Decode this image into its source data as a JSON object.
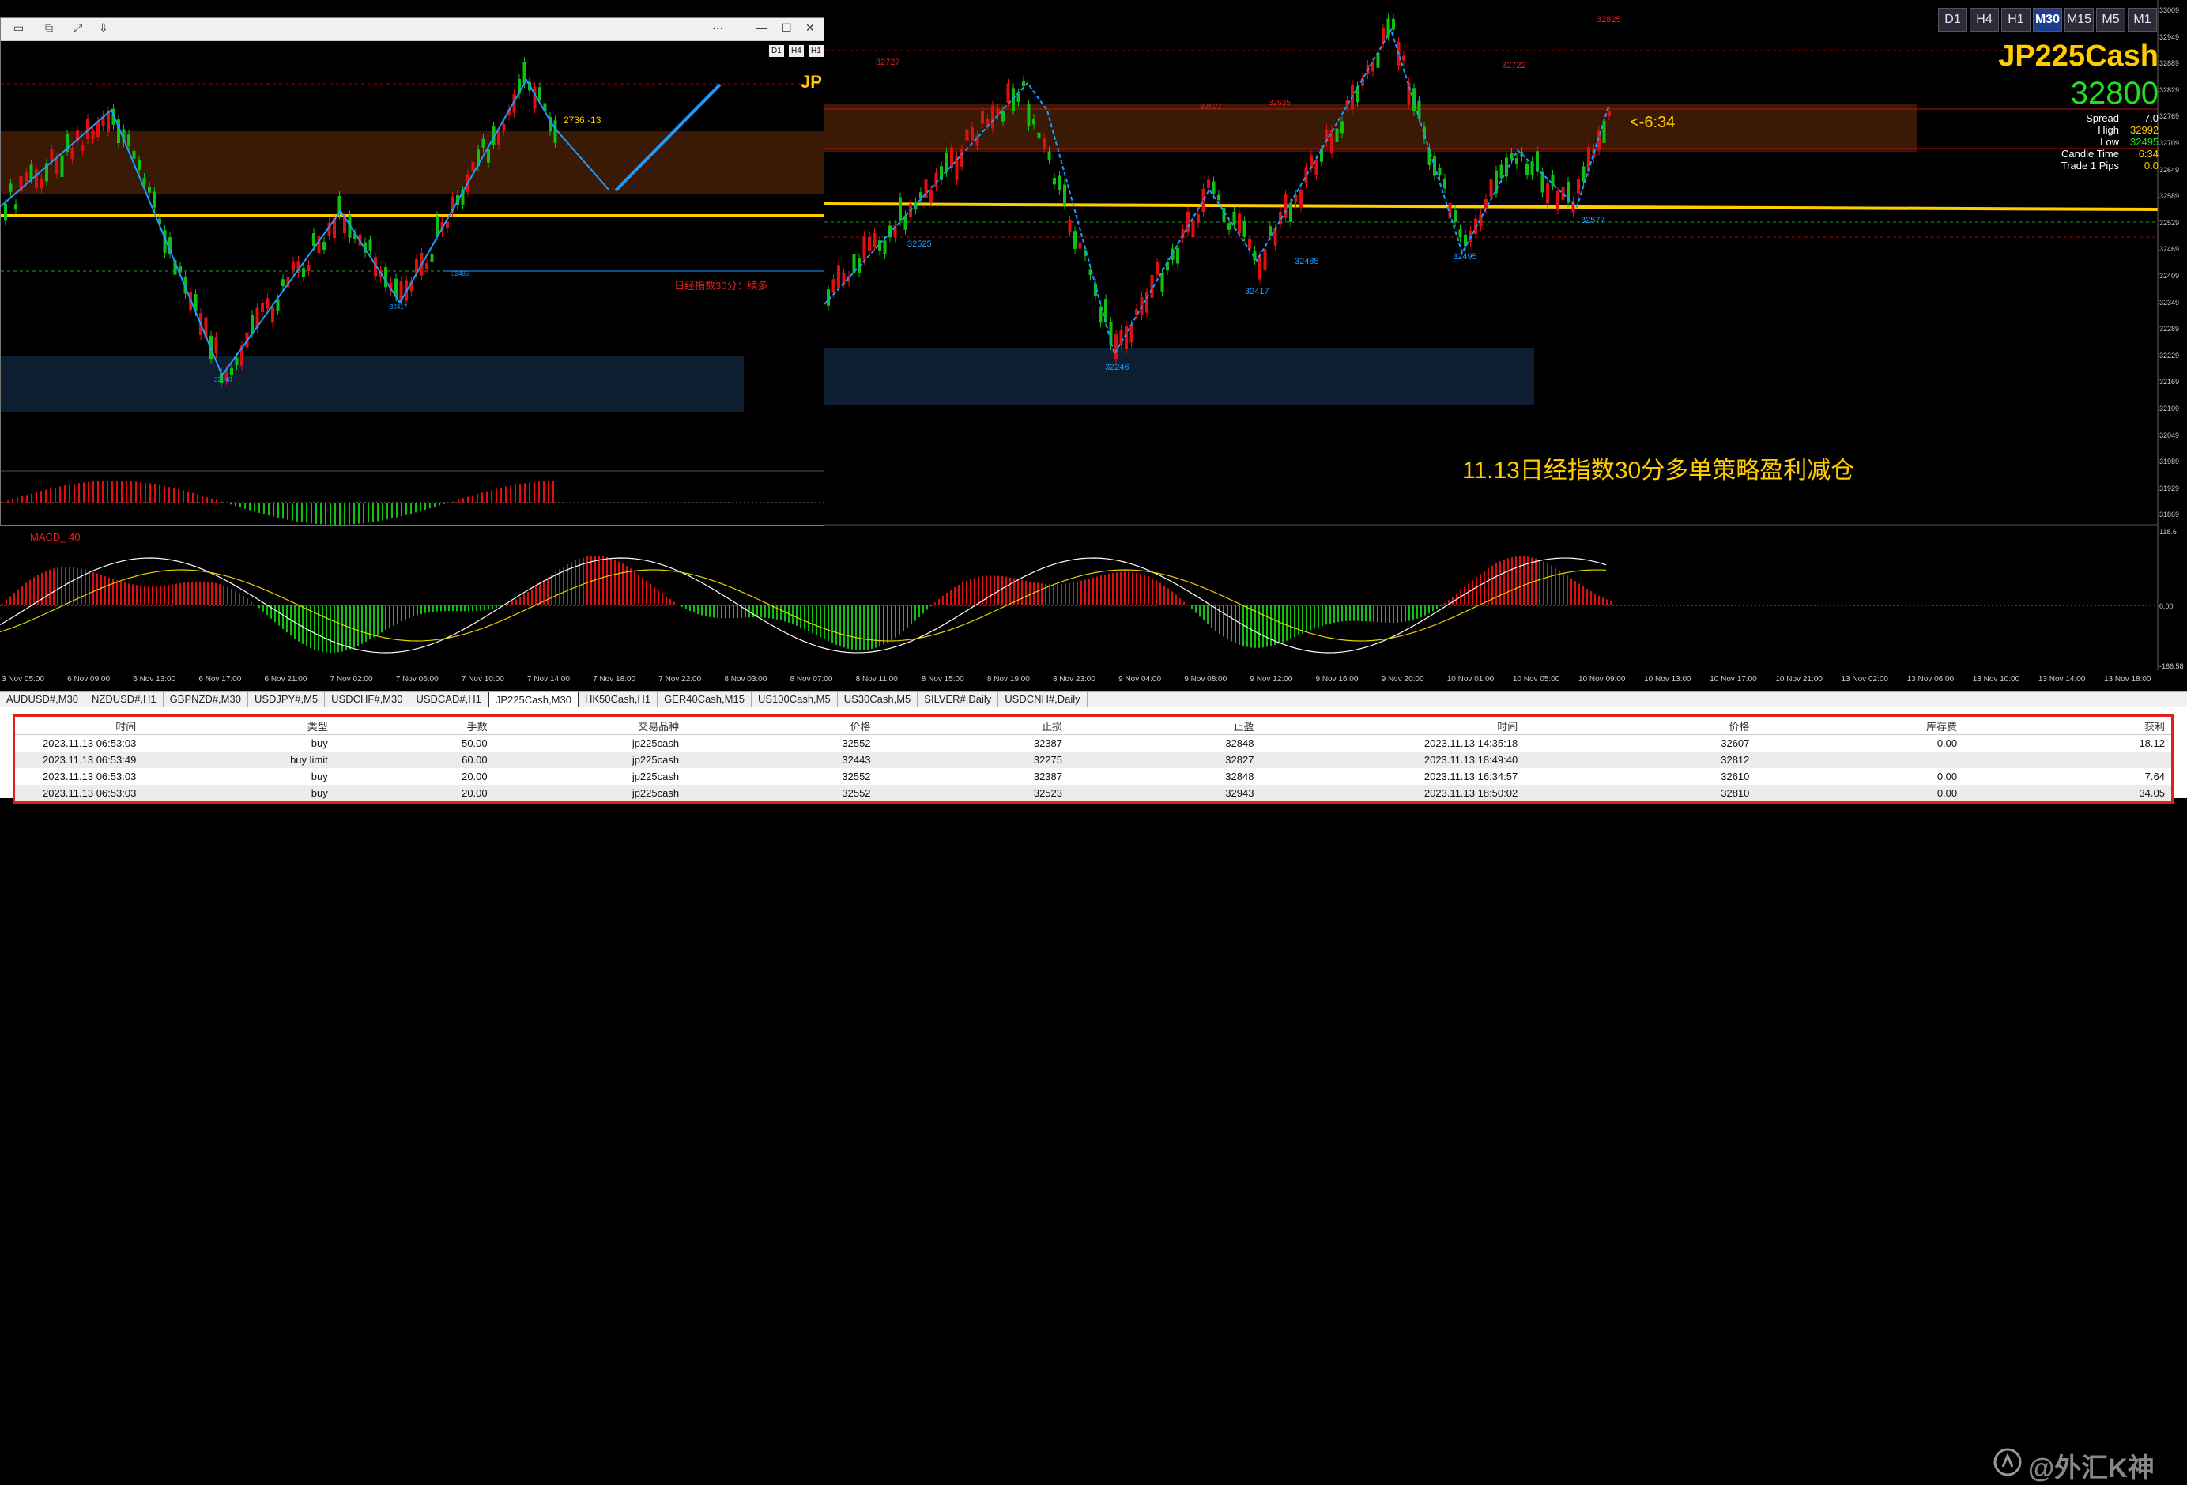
{
  "symbol": {
    "name": "JP225Cash",
    "price": "32800",
    "spread_label": "Spread",
    "spread": "7.0",
    "high_label": "High",
    "high": "32992",
    "low_label": "Low",
    "low": "32495",
    "candle_label": "Candle Time",
    "candle_time": "6:34",
    "trade_label": "Trade 1 Pips",
    "trade_pips": "0.0"
  },
  "timeframes": [
    {
      "label": "D1",
      "active": false
    },
    {
      "label": "H4",
      "active": false
    },
    {
      "label": "H1",
      "active": false
    },
    {
      "label": "M30",
      "active": true
    },
    {
      "label": "M15",
      "active": false
    },
    {
      "label": "M5",
      "active": false
    },
    {
      "label": "M1",
      "active": false
    }
  ],
  "chart": {
    "countdown": "<-6:34",
    "caption": "11.13日经指数30分多单策略盈利减仓",
    "macd_label": "MACD_ 40",
    "labels": {
      "high_32825": "32825",
      "l_32727": "32727",
      "l_32722": "32722",
      "l_32627": "32627",
      "l_32635": "32635",
      "l_32525": "32525",
      "l_32246": "32246",
      "l_32417": "32417",
      "l_32485": "32485",
      "l_32495": "32495",
      "l_32577": "32577"
    },
    "price_axis": [
      "33009",
      "32949",
      "32889",
      "32829",
      "32769",
      "32709",
      "32649",
      "32589",
      "32529",
      "32469",
      "32409",
      "32349",
      "32289",
      "32229",
      "32169",
      "32109",
      "32049",
      "31989",
      "31929",
      "31869"
    ],
    "macd_axis": [
      "118.6",
      "0.00",
      "-166.58"
    ],
    "date_axis": [
      "3 Nov 05:00",
      "6 Nov 09:00",
      "6 Nov 13:00",
      "6 Nov 17:00",
      "6 Nov 21:00",
      "7 Nov 02:00",
      "7 Nov 06:00",
      "7 Nov 10:00",
      "7 Nov 14:00",
      "7 Nov 18:00",
      "7 Nov 22:00",
      "8 Nov 03:00",
      "8 Nov 07:00",
      "8 Nov 11:00",
      "8 Nov 15:00",
      "8 Nov 19:00",
      "8 Nov 23:00",
      "9 Nov 04:00",
      "9 Nov 08:00",
      "9 Nov 12:00",
      "9 Nov 16:00",
      "9 Nov 20:00",
      "10 Nov 01:00",
      "10 Nov 05:00",
      "10 Nov 09:00",
      "10 Nov 13:00",
      "10 Nov 17:00",
      "10 Nov 21:00",
      "13 Nov 02:00",
      "13 Nov 06:00",
      "13 Nov 10:00",
      "13 Nov 14:00",
      "13 Nov 18:00"
    ]
  },
  "float_window": {
    "ticker_partial": "JP",
    "annotation": "2736:-13",
    "note": "日经指数30分：续多",
    "mini_tf": [
      "D1",
      "H4",
      "H1"
    ],
    "labels": {
      "a": "32246",
      "b": "32417",
      "c": "32485"
    }
  },
  "tabs": [
    {
      "label": "AUDUSD#,M30",
      "active": false
    },
    {
      "label": "NZDUSD#,H1",
      "active": false
    },
    {
      "label": "GBPNZD#,M30",
      "active": false
    },
    {
      "label": "USDJPY#,M5",
      "active": false
    },
    {
      "label": "USDCHF#,M30",
      "active": false
    },
    {
      "label": "USDCAD#,H1",
      "active": false
    },
    {
      "label": "JP225Cash,M30",
      "active": true
    },
    {
      "label": "HK50Cash,H1",
      "active": false
    },
    {
      "label": "GER40Cash,M15",
      "active": false
    },
    {
      "label": "US100Cash,M5",
      "active": false
    },
    {
      "label": "US30Cash,M5",
      "active": false
    },
    {
      "label": "SILVER#,Daily",
      "active": false
    },
    {
      "label": "USDCNH#,Daily",
      "active": false
    }
  ],
  "table": {
    "headers": [
      "时间",
      "类型",
      "手数",
      "交易品种",
      "价格",
      "止损",
      "止盈",
      "时间",
      "价格",
      "库存费",
      "获利"
    ],
    "rows": [
      [
        "2023.11.13 06:53:03",
        "buy",
        "50.00",
        "jp225cash",
        "32552",
        "32387",
        "32848",
        "2023.11.13 14:35:18",
        "32607",
        "0.00",
        "18.12"
      ],
      [
        "2023.11.13 06:53:49",
        "buy limit",
        "60.00",
        "jp225cash",
        "32443",
        "32275",
        "32827",
        "2023.11.13 18:49:40",
        "32812",
        "",
        ""
      ],
      [
        "2023.11.13 06:53:03",
        "buy",
        "20.00",
        "jp225cash",
        "32552",
        "32387",
        "32848",
        "2023.11.13 16:34:57",
        "32610",
        "0.00",
        "7.64"
      ],
      [
        "2023.11.13 06:53:03",
        "buy",
        "20.00",
        "jp225cash",
        "32552",
        "32523",
        "32943",
        "2023.11.13 18:50:02",
        "32810",
        "0.00",
        "34.05"
      ]
    ]
  },
  "watermark": "@外汇K神",
  "colors": {
    "up": "#e01010",
    "down": "#10c010",
    "zigzag": "#1e9bff",
    "yellow": "#ffcc00",
    "zone": "#3a1a05",
    "bluezone": "#0c1e30"
  }
}
